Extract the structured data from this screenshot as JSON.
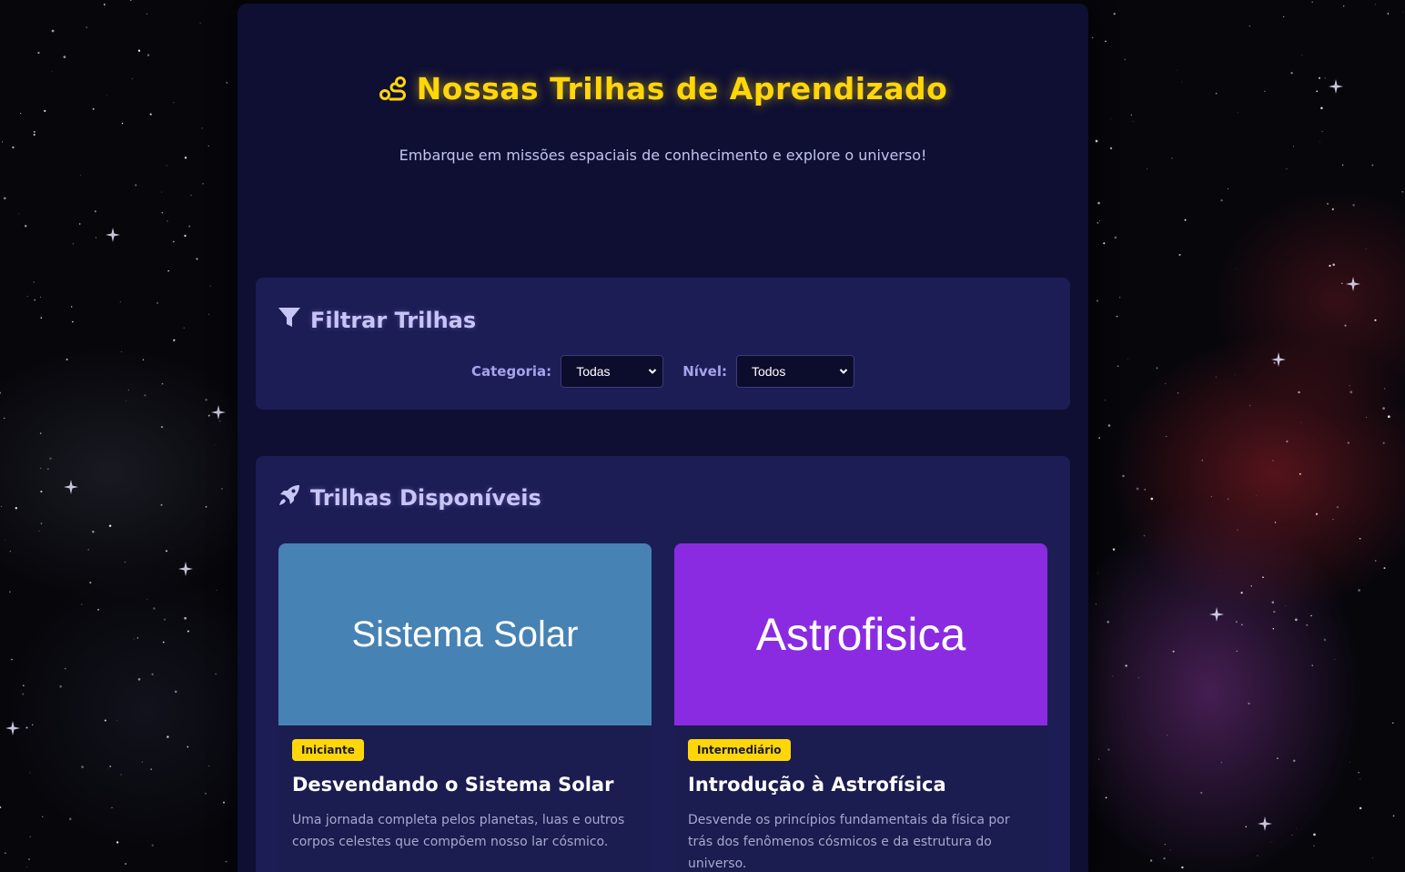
{
  "header": {
    "title": "Nossas Trilhas de Aprendizado",
    "title_icon": "route-icon",
    "subtitle": "Embarque em missões espaciais de conhecimento e explore o universo!"
  },
  "filters": {
    "heading": "Filtrar Trilhas",
    "heading_icon": "filter-icon",
    "category_label": "Categoria:",
    "category_value": "Todas",
    "level_label": "Nível:",
    "level_value": "Todos"
  },
  "tracks": {
    "heading": "Trilhas Disponíveis",
    "heading_icon": "rocket-icon",
    "cards": [
      {
        "image_text": "Sistema Solar",
        "image_color": "#4682b4",
        "level": "Iniciante",
        "title": "Desvendando o Sistema Solar",
        "description": "Uma jornada completa pelos planetas, luas e outros corpos celestes que compõem nosso lar cósmico."
      },
      {
        "image_text": "Astrofisica",
        "image_color": "#8a2be2",
        "level": "Intermediário",
        "title": "Introdução à Astrofísica",
        "description": "Desvende os princípios fundamentais da física por trás dos fenômenos cósmicos e da estrutura do universo."
      }
    ]
  },
  "colors": {
    "accent": "#ffd60a",
    "panel": "#1d1d55",
    "container": "#0e0f33"
  }
}
